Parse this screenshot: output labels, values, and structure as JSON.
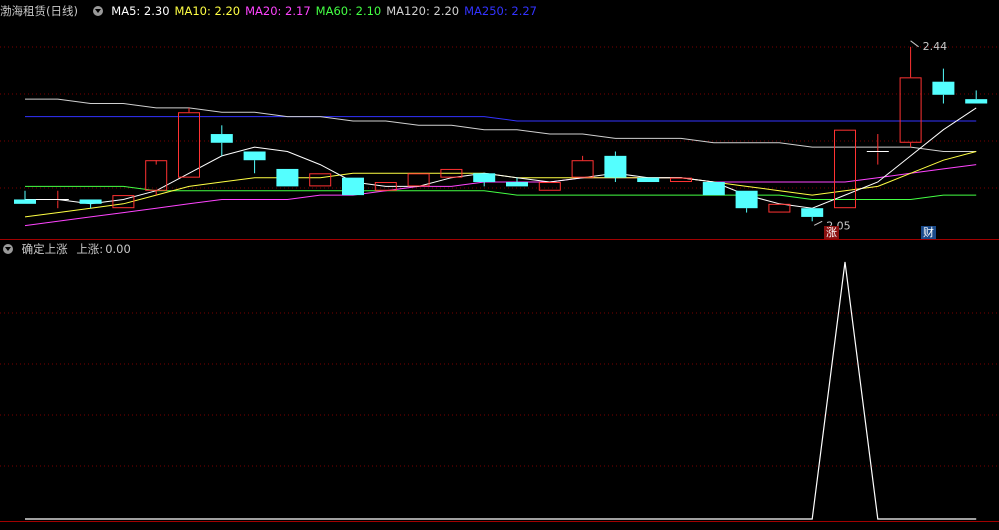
{
  "header": {
    "stock_name": "渤海租赁",
    "period": "(日线)",
    "indicators": [
      {
        "label": "MA5:",
        "value": "2.30",
        "color": "#ffffff"
      },
      {
        "label": "MA10:",
        "value": "2.20",
        "color": "#ffff44"
      },
      {
        "label": "MA20:",
        "value": "2.17",
        "color": "#ff44ff"
      },
      {
        "label": "MA60:",
        "value": "2.10",
        "color": "#44ff44"
      },
      {
        "label": "MA120:",
        "value": "2.20",
        "color": "#d0d0d0"
      },
      {
        "label": "MA250:",
        "value": "2.27",
        "color": "#3333ff"
      }
    ]
  },
  "sub_header": {
    "indicator_name": "确定上涨",
    "series_label": "上涨:",
    "value": "0.00"
  },
  "annotations": {
    "high_label": "2.44",
    "low_label": "2.05",
    "badge_zhang": "涨",
    "badge_cai": "财"
  },
  "colors": {
    "up": "#ff3232",
    "down": "#54ffff",
    "grid": "#7a0000",
    "border": "#a00000",
    "ma5": "#ffffff",
    "ma10": "#ffff44",
    "ma20": "#ff44ff",
    "ma60": "#44ff44",
    "ma120": "#d0d0d0",
    "ma250": "#3333ff",
    "signal": "#ffffff"
  },
  "chart_data": [
    {
      "type": "candlestick",
      "ylim": [
        2.02,
        2.49
      ],
      "candles": [
        {
          "o": 2.09,
          "h": 2.11,
          "l": 2.08,
          "c": 2.08
        },
        {
          "o": 2.09,
          "h": 2.11,
          "l": 2.07,
          "c": 2.09
        },
        {
          "o": 2.09,
          "h": 2.09,
          "l": 2.07,
          "c": 2.08
        },
        {
          "o": 2.07,
          "h": 2.1,
          "l": 2.07,
          "c": 2.1
        },
        {
          "o": 2.11,
          "h": 2.17,
          "l": 2.1,
          "c": 2.18
        },
        {
          "o": 2.14,
          "h": 2.3,
          "l": 2.14,
          "c": 2.29
        },
        {
          "o": 2.24,
          "h": 2.26,
          "l": 2.19,
          "c": 2.22
        },
        {
          "o": 2.2,
          "h": 2.2,
          "l": 2.15,
          "c": 2.18
        },
        {
          "o": 2.16,
          "h": 2.16,
          "l": 2.12,
          "c": 2.12
        },
        {
          "o": 2.12,
          "h": 2.15,
          "l": 2.12,
          "c": 2.15
        },
        {
          "o": 2.14,
          "h": 2.14,
          "l": 2.1,
          "c": 2.1
        },
        {
          "o": 2.11,
          "h": 2.13,
          "l": 2.11,
          "c": 2.13
        },
        {
          "o": 2.12,
          "h": 2.15,
          "l": 2.12,
          "c": 2.15
        },
        {
          "o": 2.14,
          "h": 2.16,
          "l": 2.14,
          "c": 2.16
        },
        {
          "o": 2.15,
          "h": 2.15,
          "l": 2.12,
          "c": 2.13
        },
        {
          "o": 2.13,
          "h": 2.14,
          "l": 2.12,
          "c": 2.12
        },
        {
          "o": 2.11,
          "h": 2.13,
          "l": 2.11,
          "c": 2.13
        },
        {
          "o": 2.14,
          "h": 2.19,
          "l": 2.14,
          "c": 2.18
        },
        {
          "o": 2.19,
          "h": 2.2,
          "l": 2.13,
          "c": 2.14
        },
        {
          "o": 2.14,
          "h": 2.14,
          "l": 2.13,
          "c": 2.13
        },
        {
          "o": 2.13,
          "h": 2.14,
          "l": 2.13,
          "c": 2.14
        },
        {
          "o": 2.13,
          "h": 2.13,
          "l": 2.1,
          "c": 2.1
        },
        {
          "o": 2.11,
          "h": 2.11,
          "l": 2.06,
          "c": 2.07
        },
        {
          "o": 2.06,
          "h": 2.08,
          "l": 2.06,
          "c": 2.08
        },
        {
          "o": 2.07,
          "h": 2.07,
          "l": 2.04,
          "c": 2.05
        },
        {
          "o": 2.07,
          "h": 2.25,
          "l": 2.07,
          "c": 2.25
        },
        {
          "o": 2.2,
          "h": 2.24,
          "l": 2.17,
          "c": 2.2
        },
        {
          "o": 2.22,
          "h": 2.44,
          "l": 2.21,
          "c": 2.37
        },
        {
          "o": 2.36,
          "h": 2.39,
          "l": 2.31,
          "c": 2.33
        },
        {
          "o": 2.32,
          "h": 2.34,
          "l": 2.31,
          "c": 2.31
        }
      ],
      "series": [
        {
          "key": "ma250",
          "values": [
            2.28,
            2.28,
            2.28,
            2.28,
            2.28,
            2.28,
            2.28,
            2.28,
            2.28,
            2.28,
            2.28,
            2.28,
            2.28,
            2.28,
            2.28,
            2.27,
            2.27,
            2.27,
            2.27,
            2.27,
            2.27,
            2.27,
            2.27,
            2.27,
            2.27,
            2.27,
            2.27,
            2.27,
            2.27,
            2.27
          ]
        },
        {
          "key": "ma120",
          "values": [
            2.32,
            2.32,
            2.31,
            2.31,
            2.3,
            2.3,
            2.29,
            2.29,
            2.28,
            2.28,
            2.27,
            2.27,
            2.26,
            2.26,
            2.25,
            2.25,
            2.24,
            2.24,
            2.23,
            2.23,
            2.23,
            2.22,
            2.22,
            2.22,
            2.21,
            2.21,
            2.21,
            2.21,
            2.2,
            2.2
          ]
        },
        {
          "key": "ma60",
          "values": [
            2.12,
            2.12,
            2.12,
            2.12,
            2.11,
            2.11,
            2.11,
            2.11,
            2.11,
            2.11,
            2.11,
            2.11,
            2.11,
            2.11,
            2.11,
            2.1,
            2.1,
            2.1,
            2.1,
            2.1,
            2.1,
            2.1,
            2.1,
            2.1,
            2.09,
            2.09,
            2.09,
            2.09,
            2.1,
            2.1
          ]
        },
        {
          "key": "ma20",
          "values": [
            2.03,
            2.04,
            2.05,
            2.06,
            2.07,
            2.08,
            2.09,
            2.09,
            2.09,
            2.1,
            2.1,
            2.11,
            2.12,
            2.12,
            2.13,
            2.13,
            2.13,
            2.14,
            2.14,
            2.14,
            2.14,
            2.13,
            2.13,
            2.13,
            2.13,
            2.13,
            2.14,
            2.15,
            2.16,
            2.17
          ]
        },
        {
          "key": "ma10",
          "values": [
            2.05,
            2.06,
            2.07,
            2.08,
            2.1,
            2.12,
            2.13,
            2.14,
            2.14,
            2.14,
            2.15,
            2.15,
            2.15,
            2.15,
            2.15,
            2.14,
            2.14,
            2.14,
            2.14,
            2.14,
            2.14,
            2.13,
            2.12,
            2.11,
            2.1,
            2.11,
            2.12,
            2.15,
            2.18,
            2.2
          ]
        },
        {
          "key": "ma5",
          "values": [
            2.09,
            2.09,
            2.08,
            2.09,
            2.11,
            2.15,
            2.19,
            2.21,
            2.2,
            2.17,
            2.13,
            2.12,
            2.12,
            2.14,
            2.15,
            2.14,
            2.13,
            2.14,
            2.15,
            2.14,
            2.14,
            2.13,
            2.1,
            2.08,
            2.07,
            2.1,
            2.13,
            2.19,
            2.25,
            2.3
          ]
        }
      ]
    },
    {
      "type": "line",
      "name": "上涨",
      "ylim": [
        0,
        1
      ],
      "values": [
        0,
        0,
        0,
        0,
        0,
        0,
        0,
        0,
        0,
        0,
        0,
        0,
        0,
        0,
        0,
        0,
        0,
        0,
        0,
        0,
        0,
        0,
        0,
        0,
        0,
        1,
        0,
        0,
        0,
        0
      ]
    }
  ]
}
